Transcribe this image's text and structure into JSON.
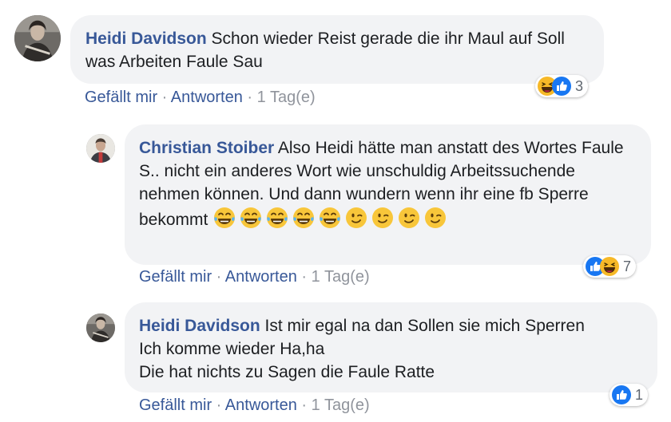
{
  "comments": [
    {
      "author": "Heidi Davidson",
      "text": " Schon wieder Reist gerade die ihr Maul auf Soll was Arbeiten Faule Sau",
      "like_label": "Gefällt mir",
      "reply_label": "Antworten",
      "separator": " · ",
      "time": "1 Tag(e)",
      "reaction_count": "3",
      "reaction_icons": [
        "haha-icon",
        "like-icon"
      ]
    },
    {
      "author": "Christian Stoiber",
      "text": " Also Heidi hätte man anstatt des Wortes Faule S.. nicht ein anderes Wort wie unschuldig Arbeitssuchende nehmen können. Und dann wundern wenn ihr eine fb Sperre bekommt ",
      "emojis": [
        "tears-of-joy",
        "tears-of-joy",
        "tears-of-joy",
        "tears-of-joy",
        "tears-of-joy",
        "wink",
        "wink",
        "wink",
        "wink"
      ],
      "like_label": "Gefällt mir",
      "reply_label": "Antworten",
      "separator": " · ",
      "time": "1 Tag(e)",
      "reaction_count": "7",
      "reaction_icons": [
        "like-icon",
        "haha-icon"
      ]
    },
    {
      "author": "Heidi Davidson",
      "text": " Ist mir egal na dan Sollen sie mich Sperren\nIch komme wieder Ha,ha\nDie hat nichts zu Sagen die Faule Ratte",
      "like_label": "Gefällt mir",
      "reply_label": "Antworten",
      "separator": " · ",
      "time": "1 Tag(e)",
      "reaction_count": "1",
      "reaction_icons": [
        "like-icon"
      ]
    }
  ],
  "colors": {
    "author": "#385898",
    "bubble": "#f2f3f5",
    "like_blue": "#1877f2",
    "haha_yellow": "#f7b928"
  }
}
